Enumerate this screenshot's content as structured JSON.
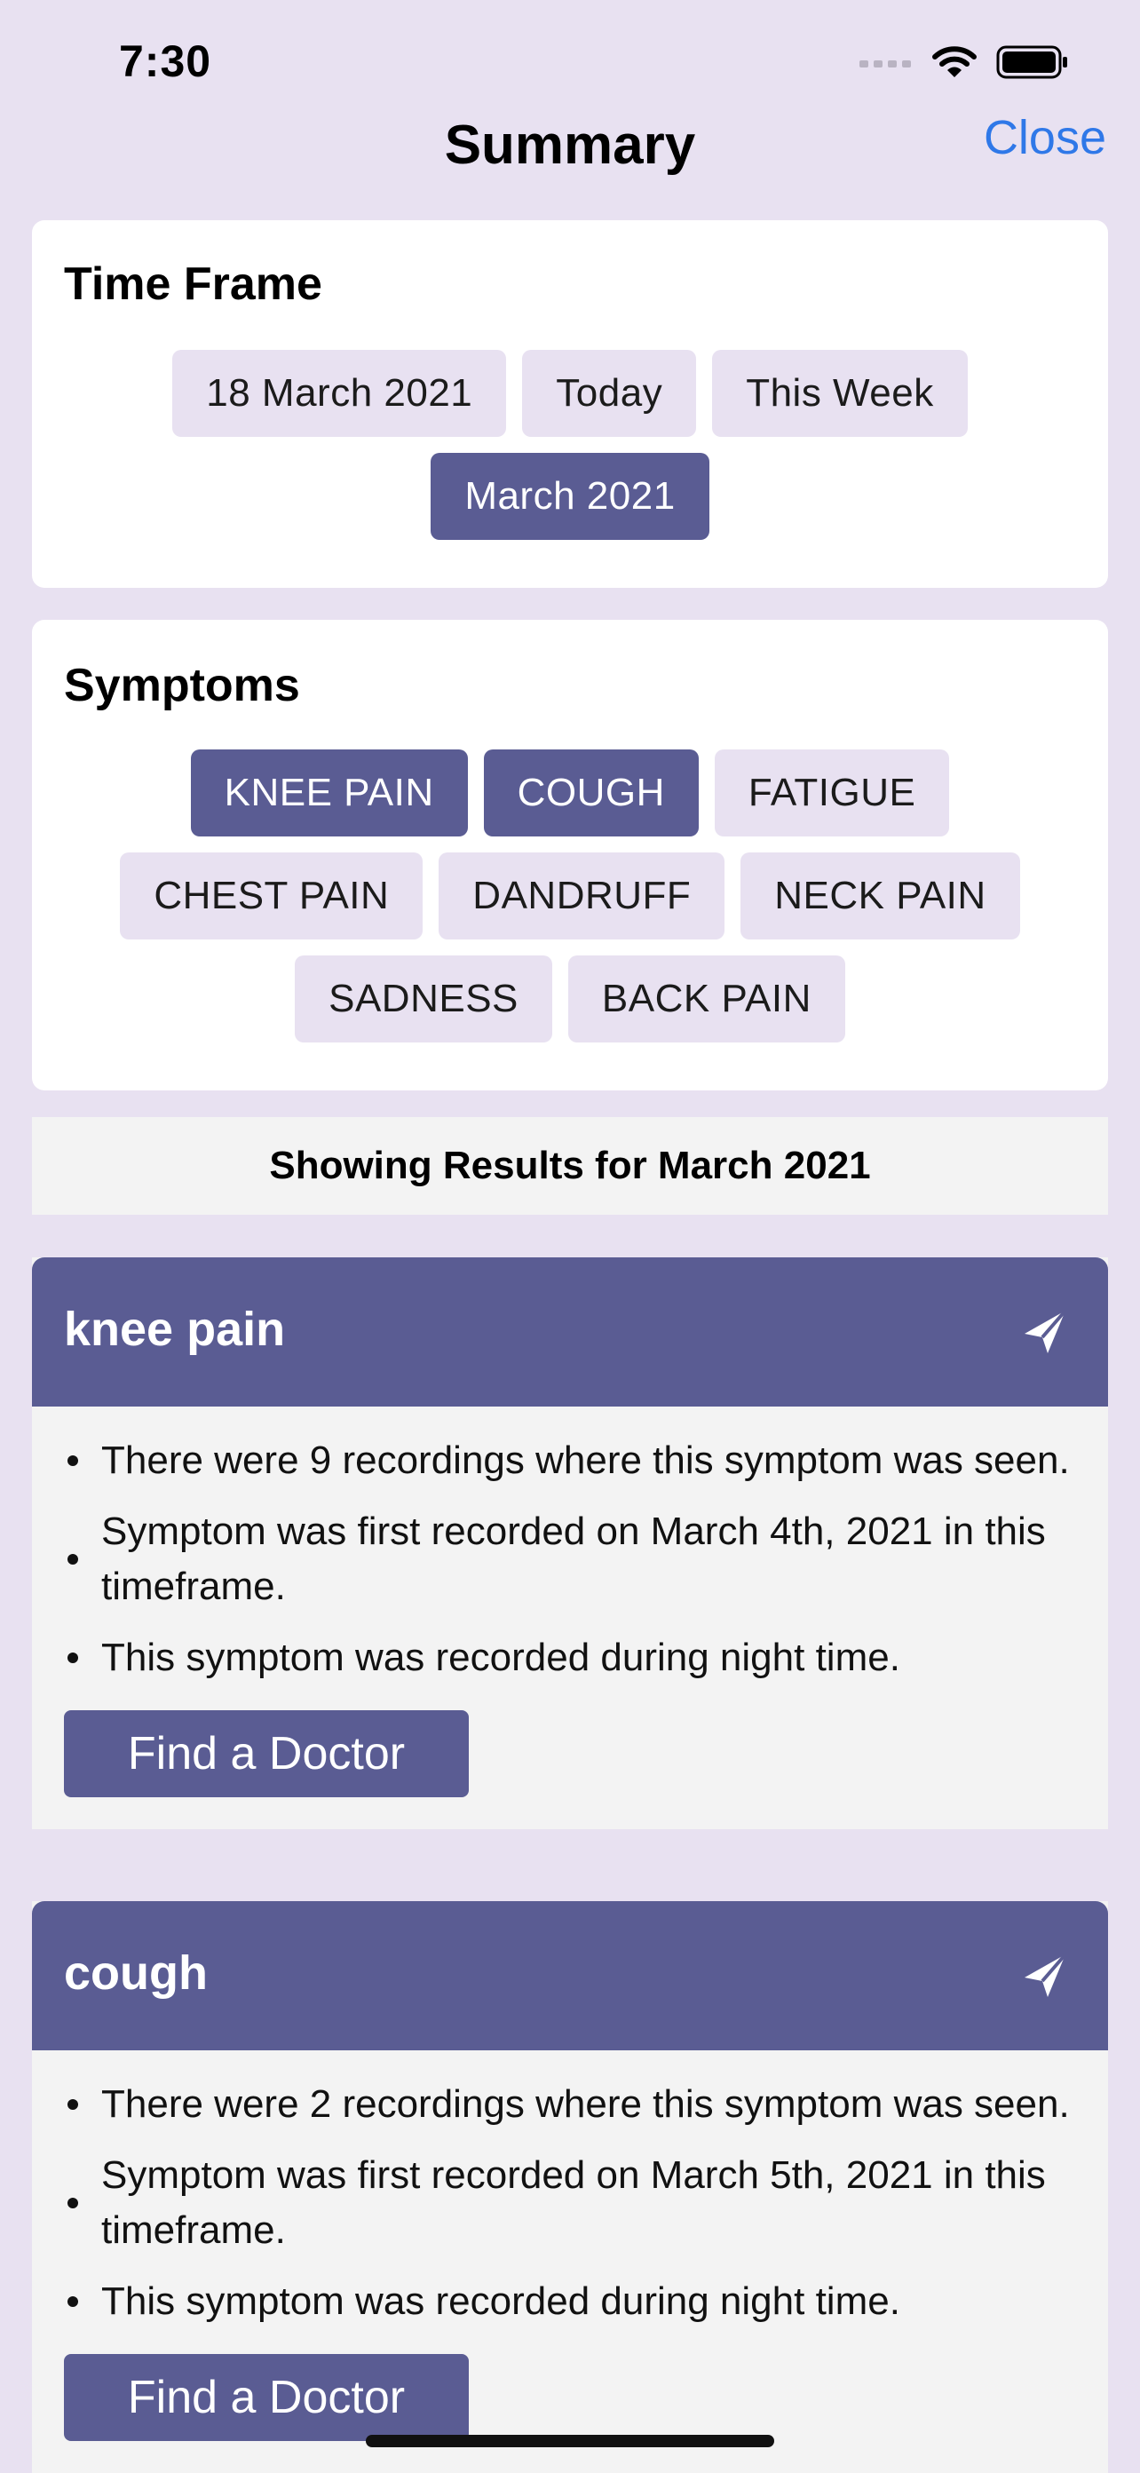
{
  "status_bar": {
    "time": "7:30"
  },
  "nav": {
    "title": "Summary",
    "close_label": "Close"
  },
  "time_frame": {
    "title": "Time Frame",
    "rows": [
      [
        {
          "label": "18 March 2021",
          "selected": false
        },
        {
          "label": "Today",
          "selected": false
        },
        {
          "label": "This Week",
          "selected": false
        }
      ],
      [
        {
          "label": "March 2021",
          "selected": true
        }
      ]
    ]
  },
  "symptoms": {
    "title": "Symptoms",
    "rows": [
      [
        {
          "label": "KNEE PAIN",
          "selected": true
        },
        {
          "label": "COUGH",
          "selected": true
        },
        {
          "label": "FATIGUE",
          "selected": false
        }
      ],
      [
        {
          "label": "CHEST PAIN",
          "selected": false
        },
        {
          "label": "DANDRUFF",
          "selected": false
        },
        {
          "label": "NECK PAIN",
          "selected": false
        }
      ],
      [
        {
          "label": "SADNESS",
          "selected": false
        },
        {
          "label": "BACK PAIN",
          "selected": false
        }
      ]
    ]
  },
  "results_label": "Showing Results for March 2021",
  "symptom_cards": [
    {
      "name": "knee pain",
      "bullets": [
        "There were 9 recordings where this symptom was seen.",
        "Symptom was first recorded on March 4th, 2021 in this timeframe.",
        "This symptom was recorded during night time."
      ],
      "button_label": "Find a Doctor"
    },
    {
      "name": "cough",
      "bullets": [
        "There were 2 recordings where this symptom was seen.",
        "Symptom was first recorded on March 5th, 2021 in this timeframe.",
        "This symptom was recorded during night time."
      ],
      "button_label": "Find a Doctor"
    }
  ],
  "colors": {
    "background": "#e8e1f1",
    "accent": "#5a5c93",
    "link": "#2f78e8",
    "chip": "#e8e1f1"
  }
}
